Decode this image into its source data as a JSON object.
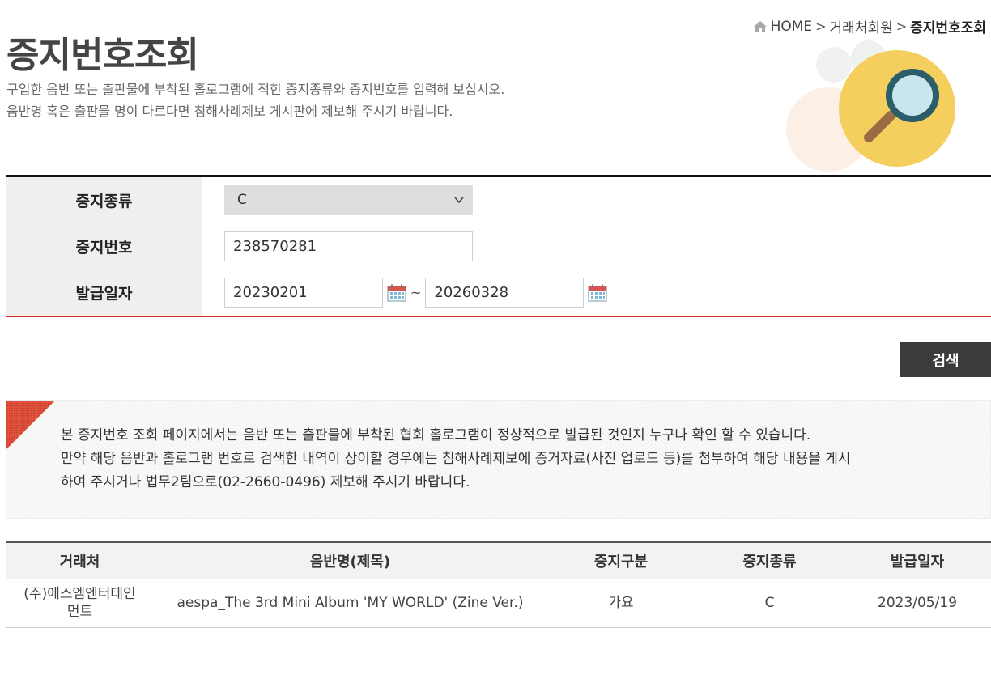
{
  "breadcrumb": {
    "home": "HOME",
    "section": "거래처회원",
    "current": "증지번호조회"
  },
  "page": {
    "title": "증지번호조회",
    "desc_line1": "구입한 음반 또는 출판물에 부착된 홀로그램에 적힌 증지종류와 증지번호를 입력해 보십시오.",
    "desc_line2": "음반명 혹은 출판물 명이 다르다면 침해사례제보 게시판에 제보해 주시기 바랍니다."
  },
  "form": {
    "type_label": "증지종류",
    "type_value": "C",
    "number_label": "증지번호",
    "number_value": "238570281",
    "date_label": "발급일자",
    "date_from": "20230201",
    "date_sep": "~",
    "date_to": "20260328",
    "search_label": "검색"
  },
  "notice": {
    "line1": "본 증지번호 조회 페이지에서는 음반 또는 출판물에 부착된 협회 홀로그램이 정상적으로 발급된 것인지 누구나 확인 할 수 있습니다.",
    "line2": "만약 해당 음반과 홀로그램 번호로 검색한 내역이 상이할 경우에는 침해사례제보에 증거자료(사진 업로드 등)를 첨부하여 해당 내용을 게시",
    "line3": "하여 주시거나 법무2팀으로(02-2660-0496) 제보해 주시기 바랍니다."
  },
  "results": {
    "headers": [
      "거래처",
      "음반명(제목)",
      "증지구분",
      "증지종류",
      "발급일자"
    ],
    "rows": [
      {
        "vendor_line1": "(주)에스엠엔터테인",
        "vendor_line2": "먼트",
        "title": "aespa_The 3rd Mini Album 'MY WORLD' (Zine Ver.)",
        "category": "가요",
        "type": "C",
        "date": "2023/05/19"
      }
    ]
  },
  "icons": {
    "home": "home-icon",
    "calendar": "calendar-icon",
    "dropdown": "chevron-down-icon",
    "hero": "magnifier-illustration"
  },
  "colors": {
    "accent_red": "#d3302c",
    "button_dark": "#3b3b3b",
    "hero_yellow": "#f4cf5d"
  }
}
